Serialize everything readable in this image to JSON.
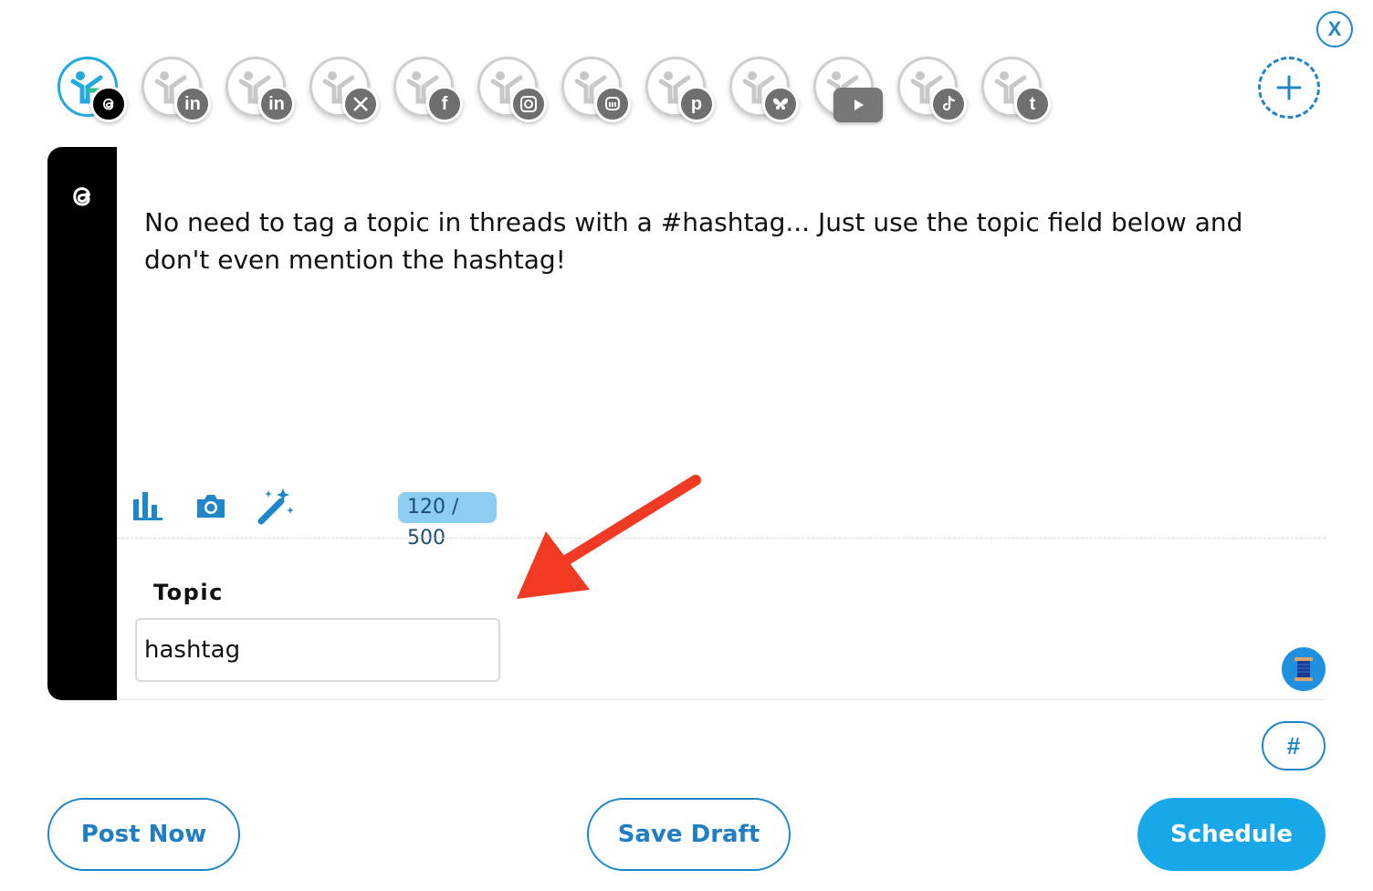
{
  "close_label": "X",
  "accounts": [
    {
      "network": "threads",
      "badge": "threads-icon",
      "active": true
    },
    {
      "network": "linkedin",
      "badge": "in"
    },
    {
      "network": "linkedin",
      "badge": "in"
    },
    {
      "network": "x",
      "badge": "x-icon"
    },
    {
      "network": "facebook",
      "badge": "f"
    },
    {
      "network": "instagram",
      "badge": "instagram-icon"
    },
    {
      "network": "mastodon",
      "badge": "mastodon-icon"
    },
    {
      "network": "pinterest",
      "badge": "p"
    },
    {
      "network": "bluesky",
      "badge": "butterfly-icon"
    },
    {
      "network": "youtube",
      "badge": "play-icon"
    },
    {
      "network": "tiktok",
      "badge": "tiktok-icon"
    },
    {
      "network": "tumblr",
      "badge": "t"
    }
  ],
  "editor": {
    "post_text": "No need to tag a topic in threads with a #hashtag... Just use the topic field below and don't even mention the hashtag!",
    "char_count": "120 / 500",
    "topic_label": "Topic",
    "topic_value": "hashtag"
  },
  "hashtag_label": "#",
  "buttons": {
    "post_now": "Post Now",
    "save_draft": "Save Draft",
    "schedule": "Schedule"
  },
  "colors": {
    "accent": "#1f86c8",
    "primary": "#18a7e8",
    "annotation_arrow": "#f03a24"
  }
}
